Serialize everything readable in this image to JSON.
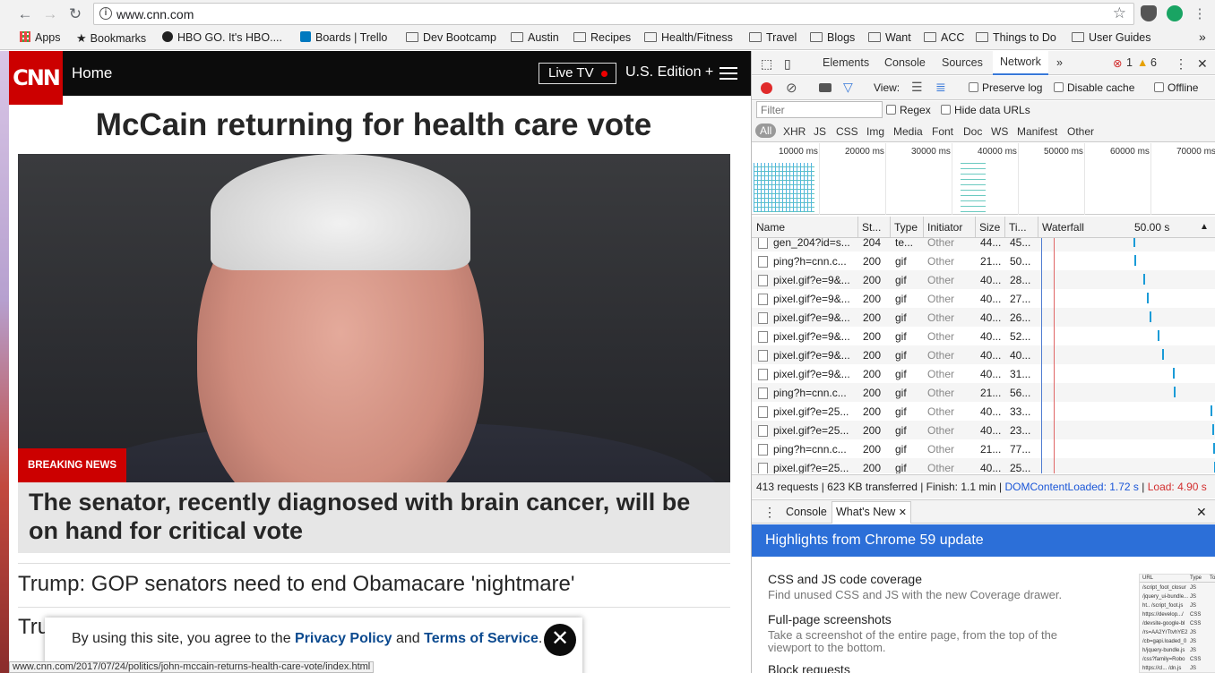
{
  "browser": {
    "url": "www.cnn.com",
    "status_url": "www.cnn.com/2017/07/24/politics/john-mccain-returns-health-care-vote/index.html",
    "bookmarks": [
      {
        "label": "Apps",
        "icon": "apps-grid-icon"
      },
      {
        "label": "Bookmarks",
        "icon": "star-icon"
      },
      {
        "label": "HBO GO. It's HBO....",
        "icon": "hbo-icon"
      },
      {
        "label": "Boards | Trello",
        "icon": "trello-icon"
      },
      {
        "label": "Dev Bootcamp",
        "icon": "folder-icon"
      },
      {
        "label": "Austin",
        "icon": "folder-icon"
      },
      {
        "label": "Recipes",
        "icon": "folder-icon"
      },
      {
        "label": "Health/Fitness",
        "icon": "folder-icon"
      },
      {
        "label": "Travel",
        "icon": "folder-icon"
      },
      {
        "label": "Blogs",
        "icon": "folder-icon"
      },
      {
        "label": "Want",
        "icon": "folder-icon"
      },
      {
        "label": "ACC",
        "icon": "folder-icon"
      },
      {
        "label": "Things to Do",
        "icon": "folder-icon"
      },
      {
        "label": "User Guides",
        "icon": "folder-icon"
      }
    ],
    "more_bookmarks": "»"
  },
  "cnn": {
    "logo": "CNN",
    "home": "Home",
    "live_tv": "Live TV",
    "edition": "U.S. Edition +",
    "headline": "McCain returning for health care vote",
    "badge": "BREAKING NEWS",
    "caption": "The senator, recently diagnosed with brain cancer, will be on hand for critical vote",
    "story1": "Trump: GOP senators need to end Obamacare 'nightmare'",
    "story2": "Tru",
    "consent_prefix": "By using this site, you agree to the ",
    "consent_privacy": "Privacy Policy",
    "consent_and": " and ",
    "consent_terms": "Terms of Service",
    "consent_end": ".",
    "close": "✕"
  },
  "devtools": {
    "tabs": [
      "Elements",
      "Console",
      "Sources",
      "Network"
    ],
    "active_tab": "Network",
    "more": "»",
    "errors": "1",
    "warnings": "6",
    "view_label": "View:",
    "preserve_log": "Preserve log",
    "disable_cache": "Disable cache",
    "offline": "Offline",
    "filter_placeholder": "Filter",
    "regex": "Regex",
    "hide_data_urls": "Hide data URLs",
    "types": [
      "All",
      "XHR",
      "JS",
      "CSS",
      "Img",
      "Media",
      "Font",
      "Doc",
      "WS",
      "Manifest",
      "Other"
    ],
    "ticks": [
      "10000 ms",
      "20000 ms",
      "30000 ms",
      "40000 ms",
      "50000 ms",
      "60000 ms",
      "70000 ms"
    ],
    "columns": {
      "name": "Name",
      "status": "St...",
      "type": "Type",
      "initiator": "Initiator",
      "size": "Size",
      "time": "Ti...",
      "waterfall": "Waterfall",
      "wf_time": "50.00 s"
    },
    "rows": [
      {
        "name": "gen_204?id=s...",
        "status": "204",
        "type": "te...",
        "initiator": "Other",
        "size": "44...",
        "time": "45..."
      },
      {
        "name": "ping?h=cnn.c...",
        "status": "200",
        "type": "gif",
        "initiator": "Other",
        "size": "21...",
        "time": "50..."
      },
      {
        "name": "pixel.gif?e=9&...",
        "status": "200",
        "type": "gif",
        "initiator": "Other",
        "size": "40...",
        "time": "28..."
      },
      {
        "name": "pixel.gif?e=9&...",
        "status": "200",
        "type": "gif",
        "initiator": "Other",
        "size": "40...",
        "time": "27..."
      },
      {
        "name": "pixel.gif?e=9&...",
        "status": "200",
        "type": "gif",
        "initiator": "Other",
        "size": "40...",
        "time": "26..."
      },
      {
        "name": "pixel.gif?e=9&...",
        "status": "200",
        "type": "gif",
        "initiator": "Other",
        "size": "40...",
        "time": "52..."
      },
      {
        "name": "pixel.gif?e=9&...",
        "status": "200",
        "type": "gif",
        "initiator": "Other",
        "size": "40...",
        "time": "40..."
      },
      {
        "name": "pixel.gif?e=9&...",
        "status": "200",
        "type": "gif",
        "initiator": "Other",
        "size": "40...",
        "time": "31..."
      },
      {
        "name": "ping?h=cnn.c...",
        "status": "200",
        "type": "gif",
        "initiator": "Other",
        "size": "21...",
        "time": "56..."
      },
      {
        "name": "pixel.gif?e=25...",
        "status": "200",
        "type": "gif",
        "initiator": "Other",
        "size": "40...",
        "time": "33..."
      },
      {
        "name": "pixel.gif?e=25...",
        "status": "200",
        "type": "gif",
        "initiator": "Other",
        "size": "40...",
        "time": "23..."
      },
      {
        "name": "ping?h=cnn.c...",
        "status": "200",
        "type": "gif",
        "initiator": "Other",
        "size": "21...",
        "time": "77..."
      },
      {
        "name": "pixel.gif?e=25...",
        "status": "200",
        "type": "gif",
        "initiator": "Other",
        "size": "40...",
        "time": "25..."
      }
    ],
    "summary_plain": "413 requests | 623 KB transferred | Finish: 1.1 min | ",
    "dom_loaded": "DOMContentLoaded: 1.72 s",
    "sep": " | ",
    "load": "Load: 4.90 s",
    "drawer_tabs": [
      "Console",
      "What's New"
    ],
    "banner": "Highlights from Chrome 59 update",
    "news": [
      {
        "title": "CSS and JS code coverage",
        "desc": "Find unused CSS and JS with the new Coverage drawer."
      },
      {
        "title": "Full-page screenshots",
        "desc": "Take a screenshot of the entire page, from the top of the viewport to the bottom."
      },
      {
        "title": "Block requests",
        "desc": ""
      }
    ],
    "thumb_headers": [
      "URL",
      "Type",
      "To"
    ],
    "thumb_rows": [
      {
        "url": "/script_foot_closur",
        "type": "JS"
      },
      {
        "url": "/jquery_ui-bundle...",
        "type": "JS"
      },
      {
        "url": "ht.. /script_foot.js",
        "type": "JS"
      },
      {
        "url": "https://develop.../",
        "type": "CSS"
      },
      {
        "url": "/devsite-google-bl",
        "type": "CSS"
      },
      {
        "url": "/rs=AA2YrTtvhYE2",
        "type": "JS"
      },
      {
        "url": "/cb=gapi.loaded_0",
        "type": "JS"
      },
      {
        "url": "h/jquery-bundle.js",
        "type": "JS"
      },
      {
        "url": "/css?family=Robo",
        "type": "CSS"
      },
      {
        "url": "https://cl... /dn.js",
        "type": "JS"
      }
    ]
  },
  "colors": {
    "cnn_red": "#cc0000",
    "devtools_blue": "#2c6fd8",
    "dom_loaded": "#1a56d8",
    "load": "#d32f2f"
  }
}
